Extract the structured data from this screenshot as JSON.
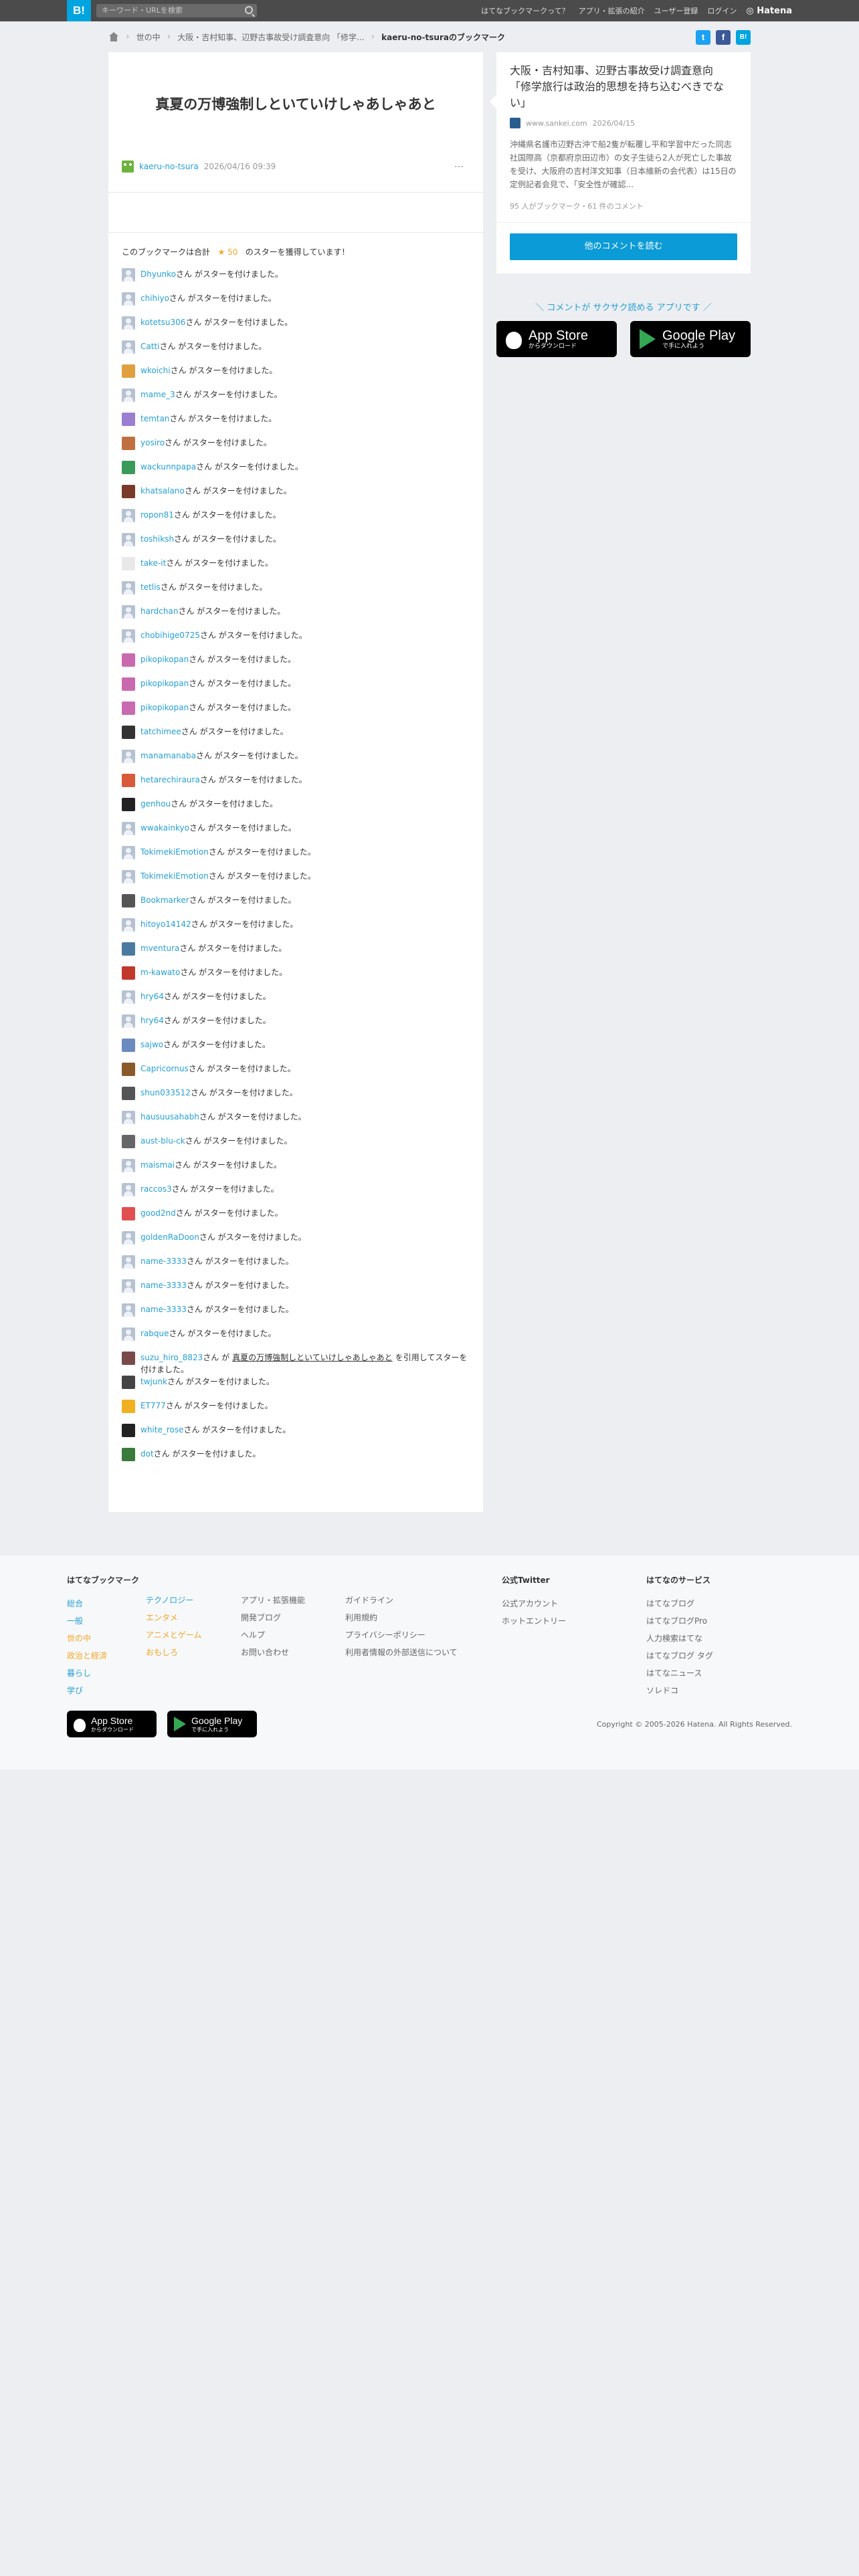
{
  "topbar": {
    "logo": "B!",
    "search_placeholder": "キーワード・URLを検索",
    "nav": [
      "はてなブックマークって？",
      "アプリ・拡張の紹介",
      "ユーザー登録",
      "ログイン"
    ],
    "hatena": "Hatena"
  },
  "breadcrumb": {
    "items": [
      "世の中",
      "大阪・吉村知事、辺野古事故受け調査意向 「修学..."
    ],
    "current": "kaeru-no-tsuraのブックマーク"
  },
  "share": {
    "twitter": "t",
    "facebook": "f",
    "hatebu": "B!"
  },
  "entry": {
    "title": "真夏の万博強制しといていけしゃあしゃあと",
    "author": "kaeru-no-tsura",
    "date": "2026/04/16 09:39",
    "more": "…"
  },
  "stars": {
    "summary_prefix": "このブックマークは合計",
    "star_glyph": "★",
    "count": "50",
    "summary_suffix": "のスターを獲得しています！",
    "suffix_text": "さん がスターを付けました。",
    "rows": [
      {
        "user": "Dhyunko",
        "av": "#b6c2d2"
      },
      {
        "user": "chihiyo",
        "av": "#b6c2d2"
      },
      {
        "user": "kotetsu306",
        "av": "#b6c2d2"
      },
      {
        "user": "Catti",
        "av": "#b6c2d2"
      },
      {
        "user": "wkoichi",
        "av": "#e0a040",
        "custom": true
      },
      {
        "user": "mame_3",
        "av": "#b6c2d2"
      },
      {
        "user": "temtan",
        "av": "#9a7fd1",
        "custom": true
      },
      {
        "user": "yosiro",
        "av": "#c07040",
        "custom": true
      },
      {
        "user": "wackunnpapa",
        "av": "#3a9a5a",
        "custom": true
      },
      {
        "user": "khatsalano",
        "av": "#7a3a2a",
        "custom": true
      },
      {
        "user": "ropon81",
        "av": "#b6c2d2"
      },
      {
        "user": "toshiksh",
        "av": "#b6c2d2"
      },
      {
        "user": "take-it",
        "av": "#e8e8e8",
        "custom": true
      },
      {
        "user": "tetlis",
        "av": "#b6c2d2"
      },
      {
        "user": "hardchan",
        "av": "#b6c2d2"
      },
      {
        "user": "chobihige0725",
        "av": "#b6c2d2"
      },
      {
        "user": "pikopikopan",
        "av": "#c96ab0",
        "custom": true
      },
      {
        "user": "pikopikopan",
        "av": "#c96ab0",
        "custom": true
      },
      {
        "user": "pikopikopan",
        "av": "#c96ab0",
        "custom": true
      },
      {
        "user": "tatchimee",
        "av": "#333333",
        "custom": true
      },
      {
        "user": "manamanaba",
        "av": "#b6c2d2"
      },
      {
        "user": "hetarechiraura",
        "av": "#d85a3a",
        "custom": true
      },
      {
        "user": "genhou",
        "av": "#222222",
        "custom": true
      },
      {
        "user": "wwakainkyo",
        "av": "#b6c2d2"
      },
      {
        "user": "TokimekiEmotion",
        "av": "#b6c2d2"
      },
      {
        "user": "TokimekiEmotion",
        "av": "#b6c2d2"
      },
      {
        "user": "Bookmarker",
        "av": "#555555",
        "custom": true
      },
      {
        "user": "hitoyo14142",
        "av": "#b6c2d2"
      },
      {
        "user": "mventura",
        "av": "#4a7aa0",
        "custom": true
      },
      {
        "user": "m-kawato",
        "av": "#c0392b",
        "custom": true
      },
      {
        "user": "hry64",
        "av": "#b6c2d2"
      },
      {
        "user": "hry64",
        "av": "#b6c2d2"
      },
      {
        "user": "sajwo",
        "av": "#6a8ac0",
        "custom": true
      },
      {
        "user": "Capricornus",
        "av": "#8a5a2a",
        "custom": true
      },
      {
        "user": "shun033512",
        "av": "#555555",
        "custom": true
      },
      {
        "user": "hausuusahabh",
        "av": "#b6c2d2"
      },
      {
        "user": "aust-blu-ck",
        "av": "#666666",
        "custom": true
      },
      {
        "user": "maismai",
        "av": "#b6c2d2"
      },
      {
        "user": "raccos3",
        "av": "#b6c2d2"
      },
      {
        "user": "good2nd",
        "av": "#e05050",
        "custom": true
      },
      {
        "user": "goldenRaDoon",
        "av": "#b6c2d2"
      },
      {
        "user": "name-3333",
        "av": "#b6c2d2"
      },
      {
        "user": "name-3333",
        "av": "#b6c2d2"
      },
      {
        "user": "name-3333",
        "av": "#b6c2d2"
      },
      {
        "user": "rabque",
        "av": "#b6c2d2"
      },
      {
        "user": "suzu_hiro_8823",
        "av": "#7a4a4a",
        "custom": true,
        "quote": true
      },
      {
        "user": "twjunk",
        "av": "#444444",
        "custom": true
      },
      {
        "user": "ET777",
        "av": "#f0b020",
        "custom": true
      },
      {
        "user": "white_rose",
        "av": "#222222",
        "custom": true
      },
      {
        "user": "dot",
        "av": "#3a7a3a",
        "custom": true
      }
    ],
    "quote_mid": "さん が",
    "quote_title": "真夏の万博強制しといていけしゃあしゃあと",
    "quote_end": "を引用してスターを付けました。"
  },
  "side": {
    "title": "大阪・吉村知事、辺野古事故受け調査意向 「修学旅行は政治的思想を持ち込むべきでない」",
    "domain": "www.sankei.com",
    "date": "2026/04/15",
    "desc": "沖縄県名護市辺野古沖で船2隻が転覆し平和学習中だった同志社国際高（京都府京田辺市）の女子生徒ら2人が死亡した事故を受け、大阪府の吉村洋文知事（日本維新の会代表）は15日の定例記者会見で、「安全性が確認...",
    "counts": "95 人がブックマーク・61 件のコメント",
    "button": "他のコメントを読む",
    "promo": "＼ コメントが サクサク読める アプリです ／",
    "appstore_small": "からダウンロード",
    "appstore_big": "App Store",
    "gplay_big": "Google Play",
    "gplay_small": "で手に入れよう"
  },
  "footer": {
    "col1_title": "はてなブックマーク",
    "col1a": [
      "総合",
      "一般",
      "世の中",
      "政治と経済",
      "暮らし",
      "学び"
    ],
    "col1b": [
      "テクノロジー",
      "エンタメ",
      "アニメとゲーム",
      "おもしろ"
    ],
    "col1c": [
      "アプリ・拡張機能",
      "開発ブログ",
      "ヘルプ",
      "お問い合わせ"
    ],
    "col1d": [
      "ガイドライン",
      "利用規約",
      "プライバシーポリシー",
      "利用者情報の外部送信について"
    ],
    "col2_title": "公式Twitter",
    "col2": [
      "公式アカウント",
      "ホットエントリー"
    ],
    "col3_title": "はてなのサービス",
    "col3": [
      "はてなブログ",
      "はてなブログPro",
      "人力検索はてな",
      "はてなブログ タグ",
      "はてなニュース",
      "ソレドコ"
    ],
    "copyright": "Copyright © 2005-2026 Hatena. All Rights Reserved."
  }
}
